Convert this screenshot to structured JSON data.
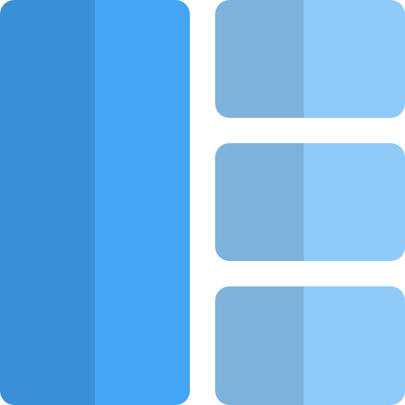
{
  "icon": {
    "name": "layout-sidebar-list-icon",
    "colors": {
      "background": "#ffffff",
      "sidebar_left": "#3A8FD6",
      "sidebar_right": "#42A5F5",
      "tile_left": "#7FB2DB",
      "tile_right": "#90CAF9"
    }
  }
}
